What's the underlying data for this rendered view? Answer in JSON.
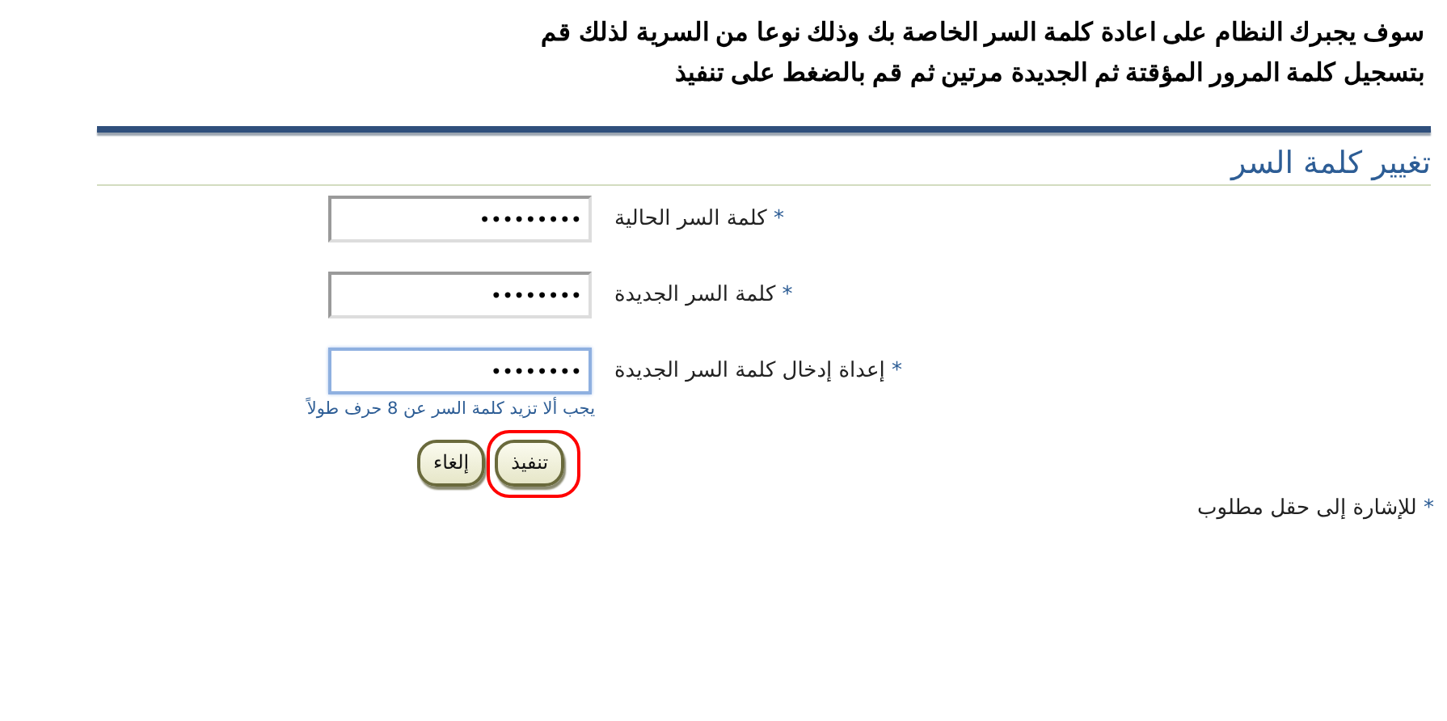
{
  "instructions": [
    "سوف يجبرك النظام على اعادة كلمة السر الخاصة بك وذلك نوعا من السرية لذلك قم",
    "بتسجيل كلمة المرور المؤقتة ثم الجديدة مرتين ثم قم بالضغط على تنفيذ"
  ],
  "page_title": "تغيير كلمة السر",
  "fields": [
    {
      "label": "كلمة السر الحالية",
      "required_mark": "*",
      "value": "•••••••••",
      "focused": false
    },
    {
      "label": "كلمة السر الجديدة",
      "required_mark": "*",
      "value": "••••••••",
      "focused": false
    },
    {
      "label": "إعداة إدخال كلمة السر الجديدة",
      "required_mark": "*",
      "value": "••••••••",
      "focused": true,
      "hint": "يجب ألا تزيد كلمة السر عن 8 حرف طولاً"
    }
  ],
  "buttons": [
    {
      "label": "تنفيذ",
      "highlighted": true
    },
    {
      "label": "إلغاء",
      "highlighted": false
    }
  ],
  "required_note": {
    "mark": "*",
    "text": "للإشارة إلى حقل مطلوب"
  }
}
